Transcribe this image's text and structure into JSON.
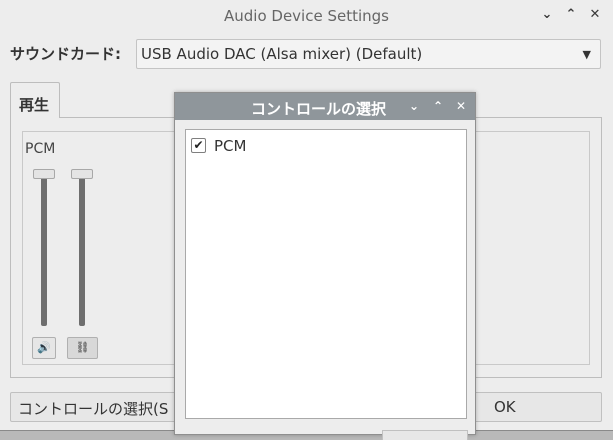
{
  "window": {
    "title": "Audio Device Settings",
    "buttons": {
      "minimize": "⌄",
      "maximize": "⌃",
      "close": "✕"
    }
  },
  "sound_card": {
    "label": "サウンドカード:",
    "selected": "USB Audio DAC (Alsa mixer) (Default)",
    "arrow": "▼"
  },
  "tabs": [
    {
      "label": "再生"
    }
  ],
  "mixer": {
    "channel_label": "PCM",
    "mute_icon": "🔊",
    "link_icon": "⛓",
    "left_level": 1.0,
    "right_level": 1.0
  },
  "bottom": {
    "select_controls_label": "コントロールの選択(S",
    "ok_label": "OK"
  },
  "dialog": {
    "title": "コントロールの選択",
    "buttons": {
      "minimize": "⌄",
      "maximize": "⌃",
      "close": "✕"
    },
    "items": [
      {
        "label": "PCM",
        "checked": true,
        "check_mark": "✔"
      }
    ]
  }
}
